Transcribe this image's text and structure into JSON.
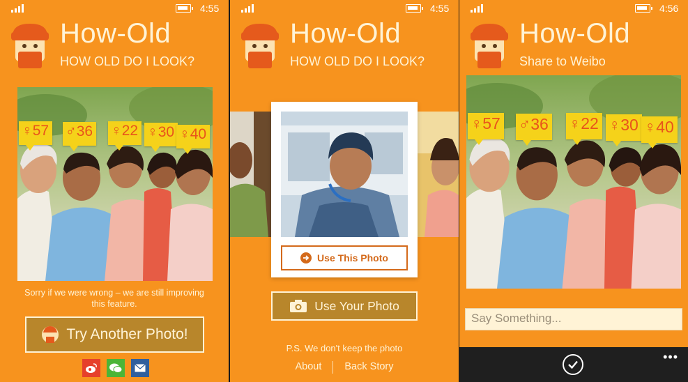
{
  "status": {
    "time1": "4:55",
    "time2": "4:55",
    "time3": "4:56"
  },
  "app": {
    "title": "How-Old",
    "subtitle": "HOW OLD DO I LOOK?",
    "share_subtitle": "Share to Weibo"
  },
  "tags": [
    {
      "gender": "♀",
      "age": "57"
    },
    {
      "gender": "♂",
      "age": "36"
    },
    {
      "gender": "♀",
      "age": "22"
    },
    {
      "gender": "♀",
      "age": "30"
    },
    {
      "gender": "♀",
      "age": "40"
    }
  ],
  "result": {
    "sorry_text": "Sorry if we were wrong – we are still improving this feature.",
    "try_another": "Try Another Photo!",
    "share_icons": [
      "weibo-icon",
      "wechat-icon",
      "mail-icon"
    ]
  },
  "picker": {
    "use_this": "Use This Photo",
    "use_your": "Use Your Photo",
    "ps": "P.S. We don't keep the photo",
    "about": "About",
    "back_story": "Back Story"
  },
  "share": {
    "placeholder": "Say Something...",
    "more": "•••"
  },
  "colors": {
    "background": "#F7931E",
    "tag": "#F5D21A",
    "tag_text": "#E8541B",
    "button": "#B8862B"
  }
}
